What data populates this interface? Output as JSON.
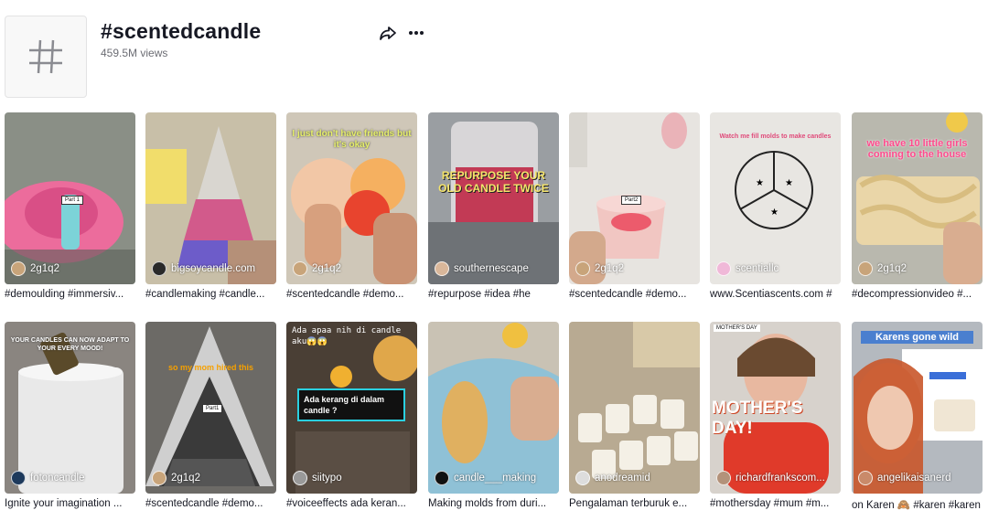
{
  "header": {
    "hashtag_title": "#scentedcandle",
    "views": "459.5M views",
    "share_icon": "share-icon",
    "more_icon": "more-icon"
  },
  "videos": [
    {
      "author": "2g1q2",
      "caption": "#demoulding #immersiv...",
      "overlay": "",
      "part": "Part 1",
      "accent": "#e86a9a"
    },
    {
      "author": "bigsoycandle.com",
      "caption": "#candlemaking #candle...",
      "overlay": "",
      "part": "",
      "accent": "#9a6bc9"
    },
    {
      "author": "2g1q2",
      "caption": "#scentedcandle #demo...",
      "overlay": "I just don't have friends but it's okay",
      "part": "",
      "accent": "#e8442e"
    },
    {
      "author": "southernescape",
      "caption": "#repurpose #idea #he",
      "overlay": "REPURPOSE YOUR OLD CANDLE TWICE",
      "part": "",
      "accent": "#c23a55"
    },
    {
      "author": "2g1q2",
      "caption": "#scentedcandle #demo...",
      "overlay": "",
      "part": "Part2",
      "accent": "#f0b7c0"
    },
    {
      "author": "scentiallc",
      "caption": "www.Scentiascents.com #",
      "overlay": "Watch me fill molds to make candles",
      "part": "",
      "accent": "#e6e6e6"
    },
    {
      "author": "2g1q2",
      "caption": "#decompressionvideo #...",
      "overlay": "we have 10 little girls coming to the house",
      "part": "",
      "accent": "#ead6a8"
    },
    {
      "author": "fotoncandle",
      "caption": "Ignite your imagination ...",
      "overlay": "YOUR CANDLES CAN NOW ADAPT TO YOUR EVERY MOOD!",
      "part": "",
      "accent": "#dcdcdc"
    },
    {
      "author": "2g1q2",
      "caption": "#scentedcandle #demo...",
      "overlay": "so my mom hired this",
      "part": "Part1",
      "accent": "#3a3a3a"
    },
    {
      "author": "siitypo",
      "caption": "#voiceeffects ada keran...",
      "overlay": "Ada apaa nih di candle aku😱😱",
      "part": "",
      "accent": "#e0a74a"
    },
    {
      "author": "candle___making",
      "caption": "Making molds from duri...",
      "overlay": "",
      "part": "",
      "accent": "#8fc1d6"
    },
    {
      "author": "anodreamid",
      "caption": "Pengalaman terburuk e...",
      "overlay": "",
      "part": "",
      "accent": "#d8c9a8"
    },
    {
      "author": "richardfrankscom...",
      "caption": "#mothersday #mum #m...",
      "overlay": "MOTHER'S DAY!",
      "part": "",
      "accent": "#e03a2a"
    },
    {
      "author": "angelikaisanerd",
      "caption": "on Karen 🙈 #karen #karen",
      "overlay": "Karens gone wild",
      "part": "",
      "accent": "#c98a6a"
    }
  ],
  "sticker_text": "Ada kerang di dalam candle ?",
  "colors": {
    "text": "#161823",
    "muted": "#6c6d74"
  }
}
